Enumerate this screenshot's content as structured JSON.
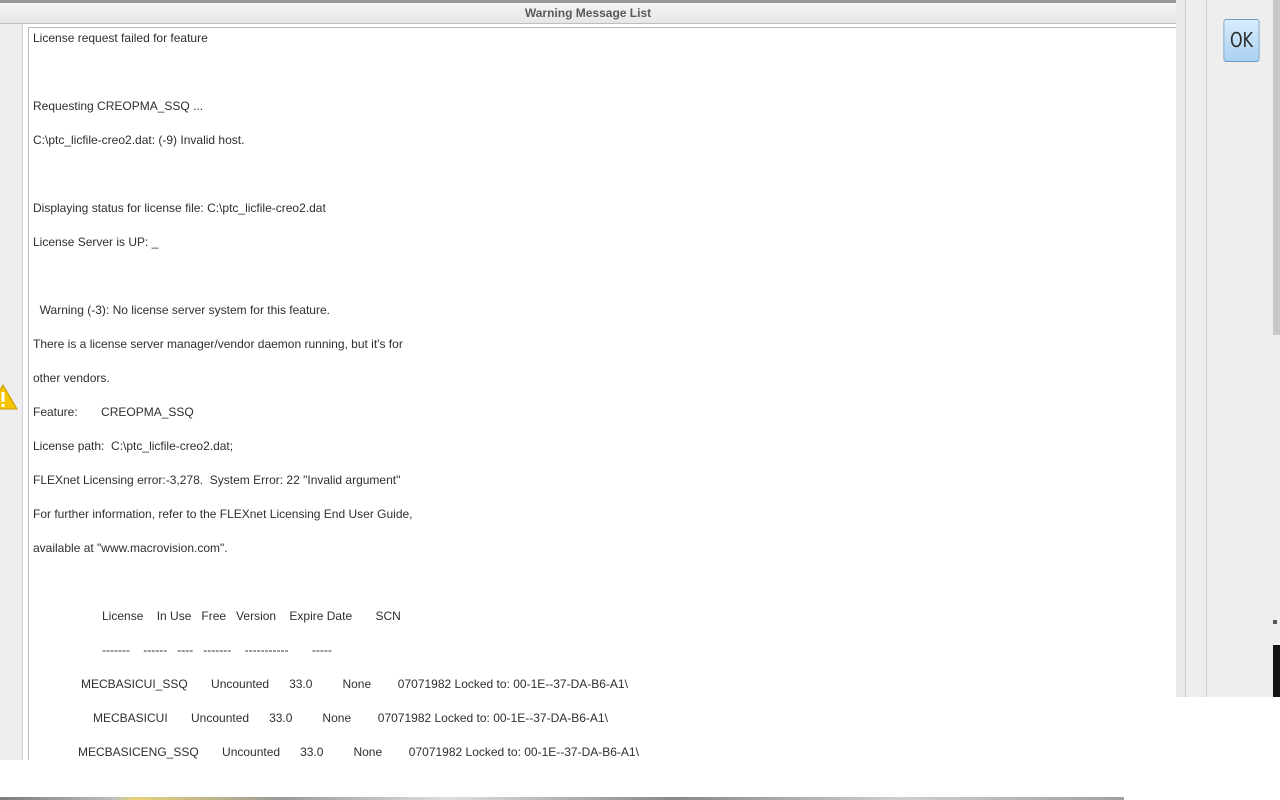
{
  "window": {
    "title": "Warning Message List"
  },
  "buttons": {
    "ok_label": "OK"
  },
  "icons": {
    "warning": "warning-triangle-icon"
  },
  "colors": {
    "ok_button_fill": "#a9d1f2",
    "warning_icon": "#f5c400"
  },
  "messages": [
    "License request failed for feature",
    "Requesting CREOPMA_SSQ ...",
    "C:\\ptc_licfile-creo2.dat: (-9) Invalid host.",
    "Displaying status for license file: C:\\ptc_licfile-creo2.dat",
    "License Server is UP: _",
    "  Warning (-3): No license server system for this feature.",
    "There is a license server manager/vendor daemon running, but it's for",
    "other vendors.",
    "Feature:       CREOPMA_SSQ",
    "License path:  C:\\ptc_licfile-creo2.dat;",
    "FLEXnet Licensing error:-3,278.  System Error: 22 \"Invalid argument\"",
    "For further information, refer to the FLEXnet Licensing End User Guide,",
    "available at \"www.macrovision.com\"."
  ],
  "license_table": {
    "header": "License    In Use   Free   Version    Expire Date       SCN",
    "separator": "-------    ------   ----   -------    -----------       -----",
    "rows": [
      "MECBASICUI_SSQ       Uncounted      33.0         None        07071982 Locked to: 00-1E--37-DA-B6-A1\\",
      "MECBASICUI       Uncounted      33.0         None        07071982 Locked to: 00-1E--37-DA-B6-A1\\",
      "MECBASICENG_SSQ       Uncounted      33.0         None        07071982 Locked to: 00-1E--37-DA-B6-A1\\"
    ]
  }
}
